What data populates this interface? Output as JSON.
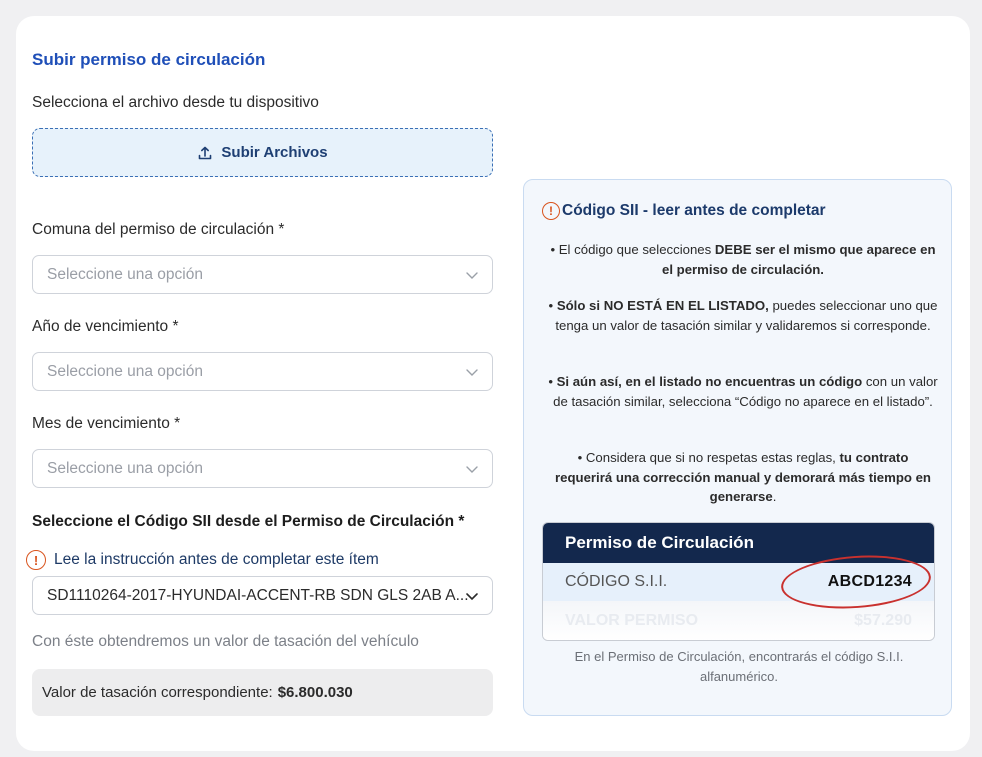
{
  "upload": {
    "title": "Subir permiso de circulación",
    "instruction": "Selecciona el archivo desde tu dispositivo",
    "button_label": "Subir Archivos"
  },
  "fields": {
    "comuna_label": "Comuna del permiso de circulación *",
    "comuna_value": "Seleccione una opción",
    "anio_label": "Año de vencimiento *",
    "anio_value": "Seleccione una opción",
    "mes_label": "Mes de vencimiento *",
    "mes_value": "Seleccione una opción",
    "sii_label": "Seleccione el Código SII desde el Permiso de Circulación *",
    "sii_warning": "Lee la instrucción antes de completar este ítem",
    "sii_value": "SD1110264-2017-HYUNDAI-ACCENT-RB SDN GLS 2AB A...",
    "hint": "Con éste obtendremos un valor de tasación del vehículo",
    "valuation_label": "Valor de tasación correspondiente:",
    "valuation_value": "$6.800.030"
  },
  "info": {
    "title": "Código SII - leer antes de completar",
    "b1_pre": "El código que selecciones ",
    "b1_bold": "DEBE ser el mismo que aparece en el permiso de circulación.",
    "b2_bold": "Sólo si NO ESTÁ EN EL LISTADO,",
    "b2_post": " puedes seleccionar uno que tenga un valor de tasación similar y validaremos si corresponde.",
    "b3_bold": "Si aún así, en el listado no encuentras un código",
    "b3_post": " con un valor de tasación similar, selecciona “Código no aparece en el listado”.",
    "b4_pre": "Considera que si no respetas estas reglas, ",
    "b4_bold": "tu contrato requerirá una corrección manual y demorará más tiempo en generarse",
    "b4_post": ".",
    "permit_title": "Permiso de Circulación",
    "permit_code_label": "CÓDIGO S.I.I.",
    "permit_code_value": "ABCD1234",
    "permit_value_label": "VALOR PERMISO",
    "permit_value_amount": "$57.290",
    "caption": "En el Permiso de Circulación, encontrarás el código S.I.I. alfanumérico."
  },
  "icons": {
    "upload": "upload-icon",
    "chevron": "chevron-down-icon",
    "warning": "exclamation-circle-icon"
  },
  "colors": {
    "title_blue": "#1f4fb8",
    "navy": "#13284d",
    "warning_orange": "#d9541e",
    "highlight_red": "#c9312e"
  }
}
